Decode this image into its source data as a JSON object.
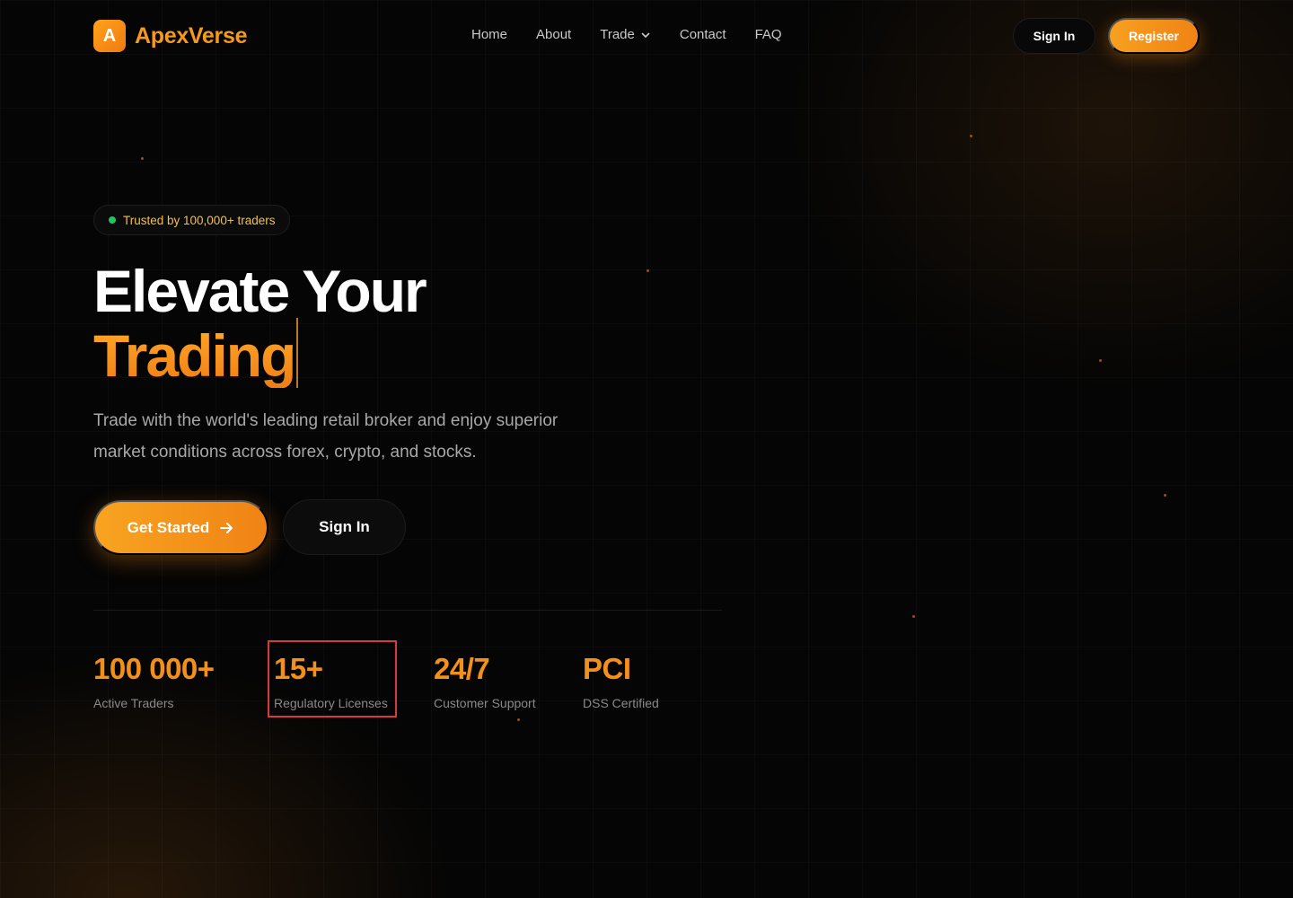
{
  "brand": {
    "logo_letter": "A",
    "name": "ApexVerse"
  },
  "nav": {
    "links": [
      {
        "label": "Home"
      },
      {
        "label": "About"
      },
      {
        "label": "Trade",
        "icon": "chevron-down-icon"
      },
      {
        "label": "Contact"
      },
      {
        "label": "FAQ"
      }
    ],
    "sign_in": "Sign In",
    "register": "Register"
  },
  "hero": {
    "badge": "Trusted by 100,000+ traders",
    "headline_line1": "Elevate Your",
    "headline_line2": "Trading",
    "subtitle": "Trade with the world's leading retail broker and enjoy superior market conditions across forex, crypto, and stocks.",
    "cta_primary": "Get Started",
    "cta_primary_icon": "arrow-right-icon",
    "cta_secondary": "Sign In"
  },
  "stats": [
    {
      "value": "100 000+",
      "label": "Active Traders"
    },
    {
      "value": "15+",
      "label": "Regulatory Licenses"
    },
    {
      "value": "24/7",
      "label": "Customer Support"
    },
    {
      "value": "PCI",
      "label": "DSS Certified"
    }
  ],
  "colors": {
    "accent": "#f39019",
    "background": "#050505",
    "badge_dot": "#22c55e",
    "highlight_box": "#d63a3a"
  }
}
